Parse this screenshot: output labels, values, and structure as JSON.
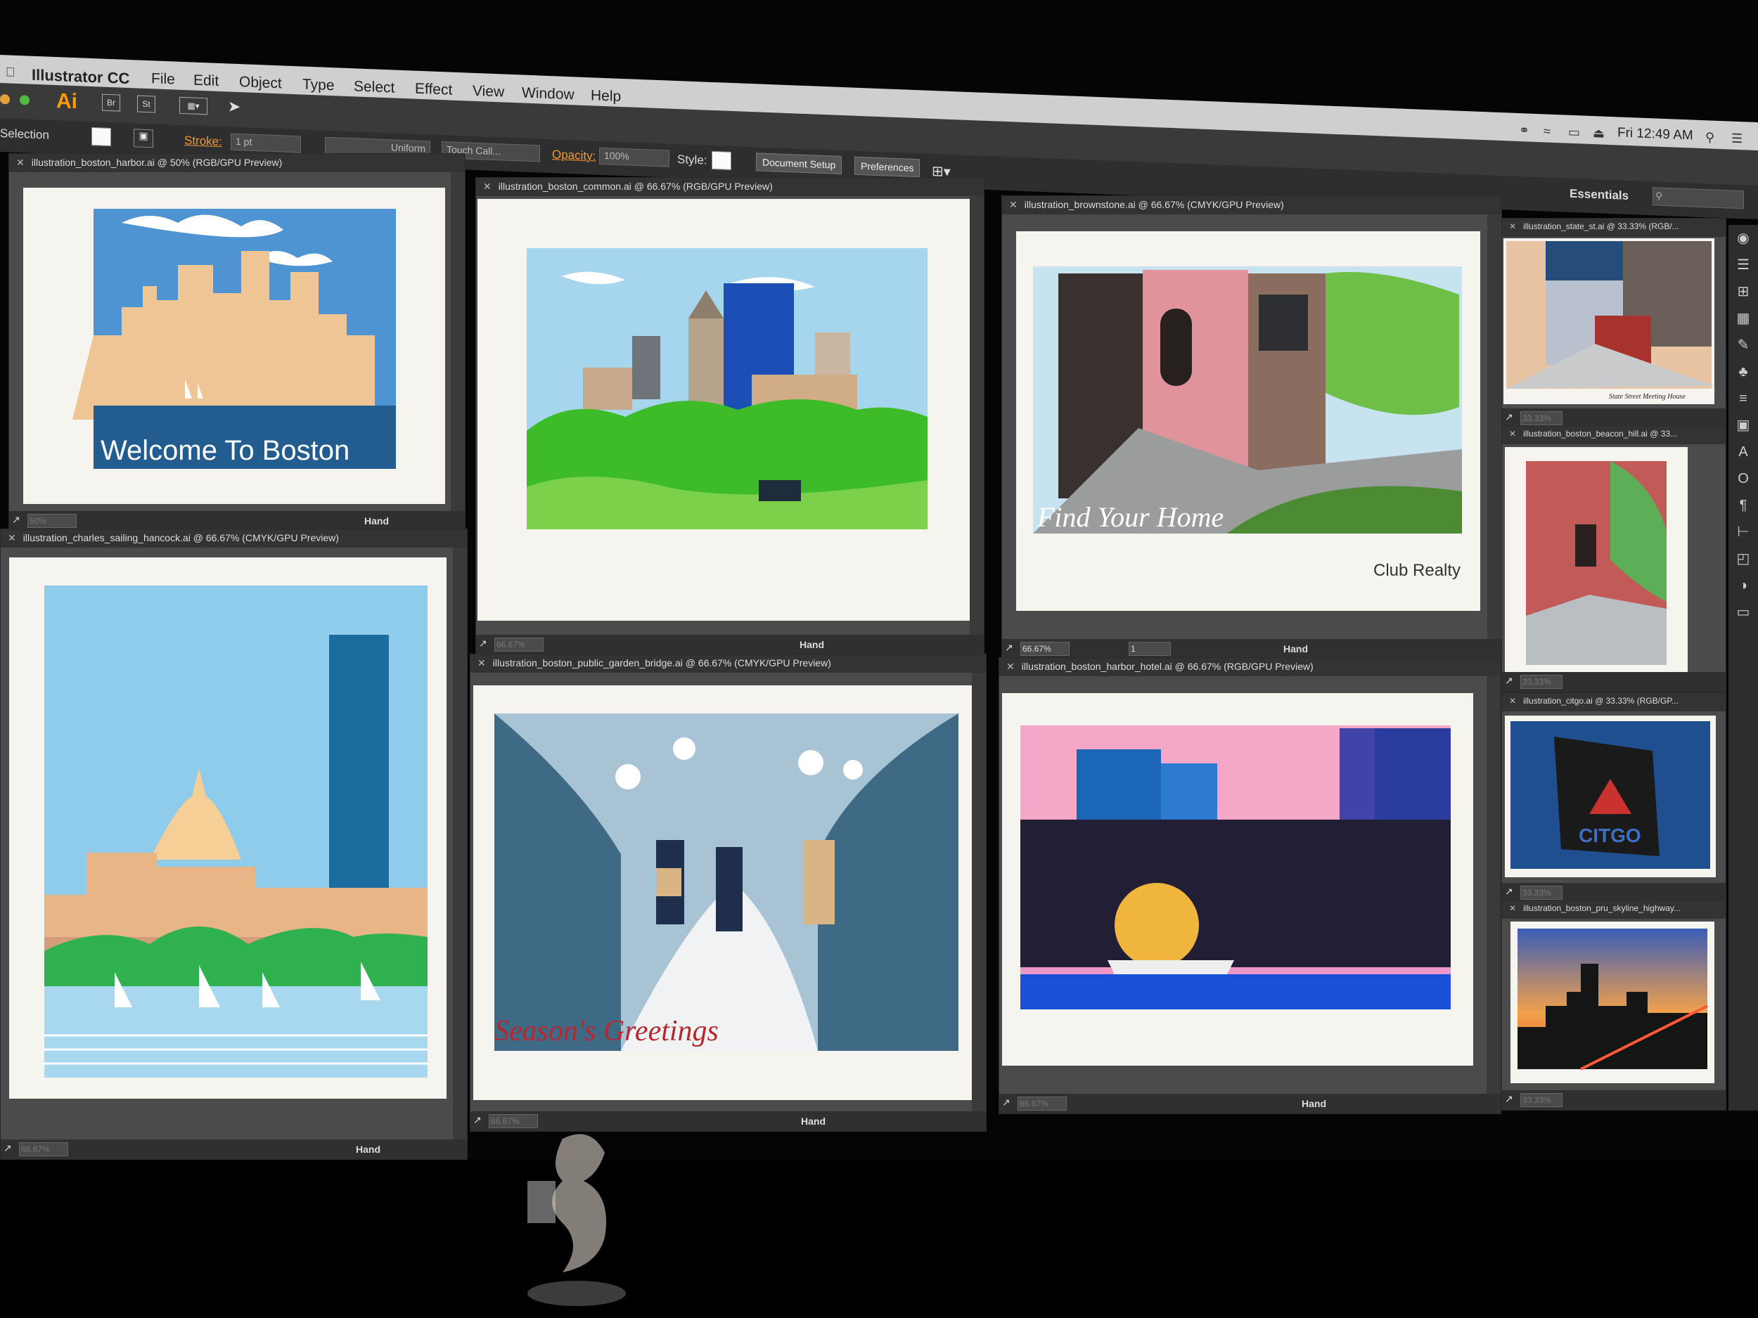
{
  "menubar": {
    "app_name": "Illustrator CC",
    "menus": [
      "File",
      "Edit",
      "Object",
      "Type",
      "Select",
      "Effect",
      "View",
      "Window",
      "Help"
    ],
    "clock": "Fri 12:49 AM"
  },
  "approw": {
    "logo": "Ai",
    "bridge": "Br",
    "stock": "St",
    "workspace": "Essentials"
  },
  "control_bar": {
    "selection_label": "Selection",
    "stroke_label": "Stroke:",
    "stroke_value": "1 pt",
    "profile": "Uniform",
    "brush": "Touch Call...",
    "opacity_label": "Opacity:",
    "opacity_value": "100%",
    "style_label": "Style:",
    "document_setup": "Document Setup",
    "preferences": "Preferences"
  },
  "colors": {
    "accent": "#f29a2e",
    "panel_bg": "#4b4b4b",
    "tab_bg": "#333333",
    "artboard": "#f6f4ee"
  },
  "windows": [
    {
      "title": "illustration_boston_harbor.ai @ 50% (RGB/GPU Preview)",
      "zoom": "50%",
      "tool": "Hand",
      "caption": "Welcome To Boston"
    },
    {
      "title": "illustration_boston_common.ai @ 66.67% (RGB/GPU Preview)",
      "zoom": "66.67%",
      "tool": "Hand",
      "caption": ""
    },
    {
      "title": "illustration_brownstone.ai @ 66.67% (CMYK/GPU Preview)",
      "zoom": "66.67%",
      "tool": "Hand",
      "caption": "Find Your Home",
      "subcaption": "Club Realty"
    },
    {
      "title": "illustration_state_st.ai @ 33.33% (RGB/...",
      "zoom": "33.33%",
      "tool": "",
      "caption": "State Street Meeting House"
    },
    {
      "title": "illustration_boston_beacon_hill.ai @ 33...",
      "zoom": "33.33%",
      "tool": "",
      "caption": ""
    },
    {
      "title": "illustration_charles_sailing_hancock.ai @ 66.67% (CMYK/GPU Preview)",
      "zoom": "66.67%",
      "tool": "Hand",
      "caption": ""
    },
    {
      "title": "illustration_boston_public_garden_bridge.ai @ 66.67% (CMYK/GPU Preview)",
      "zoom": "66.67%",
      "tool": "Hand",
      "caption": "Season's Greetings"
    },
    {
      "title": "illustration_boston_harbor_hotel.ai @ 66.67% (RGB/GPU Preview)",
      "zoom": "66.67%",
      "tool": "Hand",
      "caption": ""
    },
    {
      "title": "illustration_citgo.ai @ 33.33% (RGB/GP...",
      "zoom": "33.33%",
      "tool": "",
      "caption": "CITGO"
    },
    {
      "title": "illustration_boston_pru_skyline_highway...",
      "zoom": "33.33%",
      "tool": "",
      "caption": ""
    }
  ],
  "page_number": "1"
}
